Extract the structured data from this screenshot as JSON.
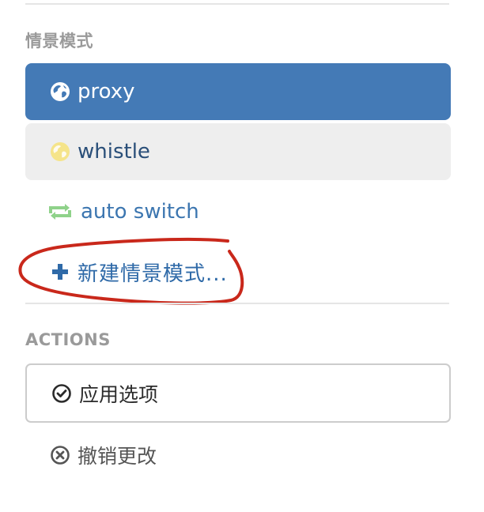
{
  "profiles_section": {
    "header": "情景模式",
    "items": [
      {
        "label": "proxy",
        "icon": "globe-icon",
        "state": "active"
      },
      {
        "label": "whistle",
        "icon": "globe-icon",
        "state": "hover"
      },
      {
        "label": "auto switch",
        "icon": "retweet-icon",
        "state": "normal"
      }
    ],
    "new_profile_label": "新建情景模式..."
  },
  "actions_section": {
    "header": "ACTIONS",
    "apply_label": "应用选项",
    "discard_label": "撤销更改"
  },
  "colors": {
    "active_bg": "#447ab6",
    "hover_bg": "#eeeeee",
    "link": "#3c76b0",
    "annotation_red": "#c9281b",
    "auto_switch_icon": "#8fd28a",
    "whistle_icon": "#f5e48a"
  }
}
